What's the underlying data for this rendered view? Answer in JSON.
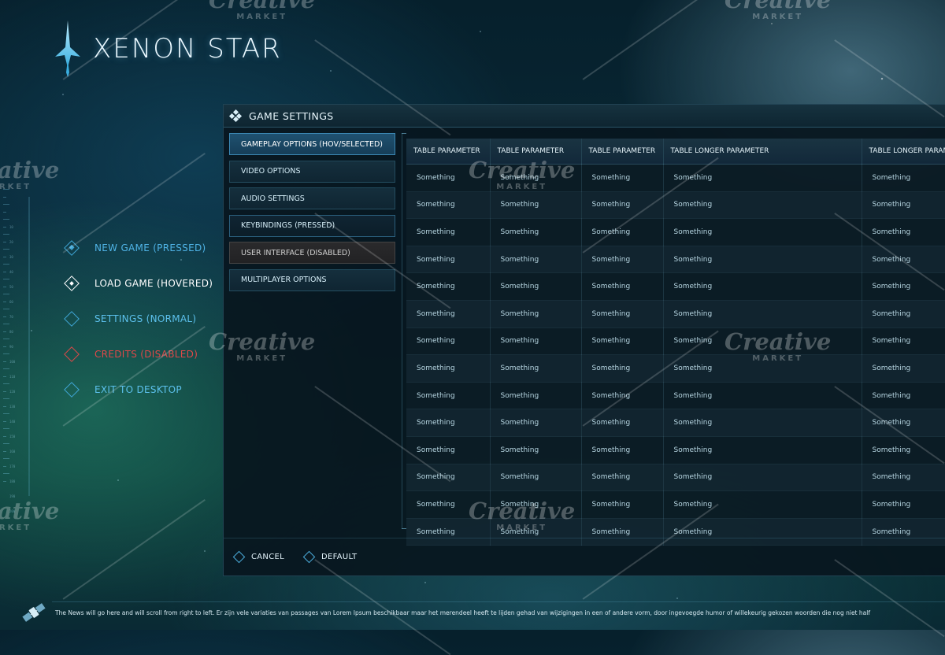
{
  "game": {
    "title": "XENON STAR"
  },
  "menu": {
    "items": [
      {
        "label": "NEW GAME (PRESSED)",
        "state": "pressed"
      },
      {
        "label": "LOAD GAME (HOVERED)",
        "state": "hovered"
      },
      {
        "label": "SETTINGS (NORMAL)",
        "state": "normal"
      },
      {
        "label": "CREDITS (DISABLED)",
        "state": "disabled"
      },
      {
        "label": "EXIT TO DESKTOP",
        "state": "normal"
      }
    ]
  },
  "panel": {
    "title": "GAME SETTINGS",
    "tabs": [
      {
        "label": "GAMEPLAY OPTIONS (HOV/SELECTED)",
        "state": "selected"
      },
      {
        "label": "VIDEO OPTIONS",
        "state": "normal"
      },
      {
        "label": "AUDIO SETTINGS",
        "state": "normal"
      },
      {
        "label": "KEYBINDINGS (PRESSED)",
        "state": "pressed"
      },
      {
        "label": "USER INTERFACE (DISABLED)",
        "state": "disabled"
      },
      {
        "label": "MULTIPLAYER OPTIONS",
        "state": "normal"
      }
    ],
    "table": {
      "headers": [
        "TABLE PARAMETER",
        "TABLE PARAMETER",
        "TABLE PARAMETER",
        "TABLE LONGER PARAMETER",
        "TABLE LONGER PARAMETER"
      ],
      "rows": [
        [
          "Something",
          "Something",
          "Something",
          "Something",
          "Something"
        ],
        [
          "Something",
          "Something",
          "Something",
          "Something",
          "Something"
        ],
        [
          "Something",
          "Something",
          "Something",
          "Something",
          "Something"
        ],
        [
          "Something",
          "Something",
          "Something",
          "Something",
          "Something"
        ],
        [
          "Something",
          "Something",
          "Something",
          "Something",
          "Something"
        ],
        [
          "Something",
          "Something",
          "Something",
          "Something",
          "Something"
        ],
        [
          "Something",
          "Something",
          "Something",
          "Something",
          "Something"
        ],
        [
          "Something",
          "Something",
          "Something",
          "Something",
          "Something"
        ],
        [
          "Something",
          "Something",
          "Something",
          "Something",
          "Something"
        ],
        [
          "Something",
          "Something",
          "Something",
          "Something",
          "Something"
        ],
        [
          "Something",
          "Something",
          "Something",
          "Something",
          "Something"
        ],
        [
          "Something",
          "Something",
          "Something",
          "Something",
          "Something"
        ],
        [
          "Something",
          "Something",
          "Something",
          "Something",
          "Something"
        ],
        [
          "Something",
          "Something",
          "Something",
          "Something",
          "Something"
        ]
      ]
    },
    "footer": {
      "cancel_label": "CANCEL",
      "default_label": "DEFAULT"
    }
  },
  "news": {
    "text": "The News will go here and will scroll from right to left. Er zijn vele variaties van passages van Lorem Ipsum beschikbaar maar het merendeel heeft te lijden gehad van wijzigingen in een of andere vorm, door ingevoegde humor of willekeurig gekozen woorden die nog niet half"
  },
  "ruler": {
    "numbers": [
      "10",
      "20",
      "30",
      "40",
      "50",
      "60",
      "70",
      "80",
      "90",
      "100",
      "110",
      "120",
      "130",
      "140",
      "150",
      "160",
      "170",
      "180",
      "190",
      "200"
    ]
  },
  "watermark": {
    "brand": "Creative",
    "sub": "MARKET"
  },
  "colors": {
    "accent": "#3fa6d6",
    "disabled": "#e04848",
    "selected": "#1f5170"
  }
}
